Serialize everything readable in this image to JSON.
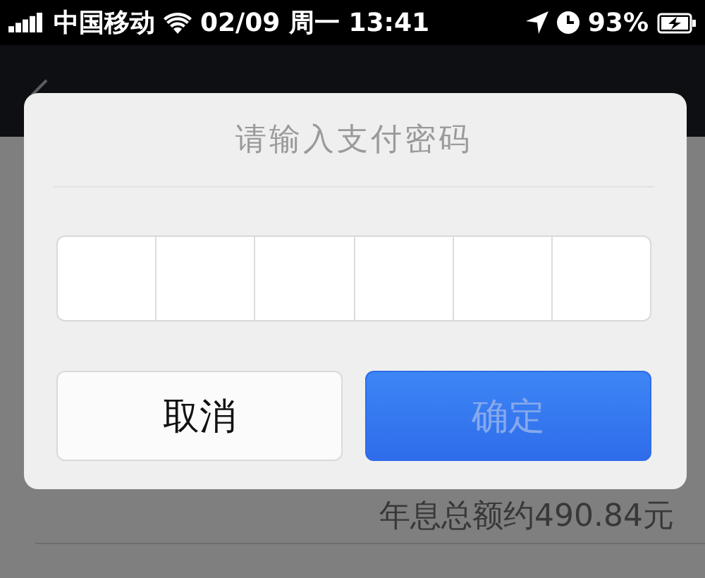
{
  "status_bar": {
    "carrier": "中国移动",
    "datetime": "02/09 周一 13:41",
    "battery": "93%"
  },
  "page": {
    "interest_total": "年息总额约490.84元"
  },
  "dialog": {
    "title": "请输入支付密码",
    "password_cells": [
      {
        "filled": false
      },
      {
        "filled": false
      },
      {
        "filled": false
      },
      {
        "filled": false
      },
      {
        "filled": false
      },
      {
        "filled": false
      }
    ],
    "buttons": [
      {
        "label": "取消",
        "kind": "cancel",
        "disabled": false
      },
      {
        "label": "确定",
        "kind": "confirm",
        "disabled": true
      }
    ]
  }
}
